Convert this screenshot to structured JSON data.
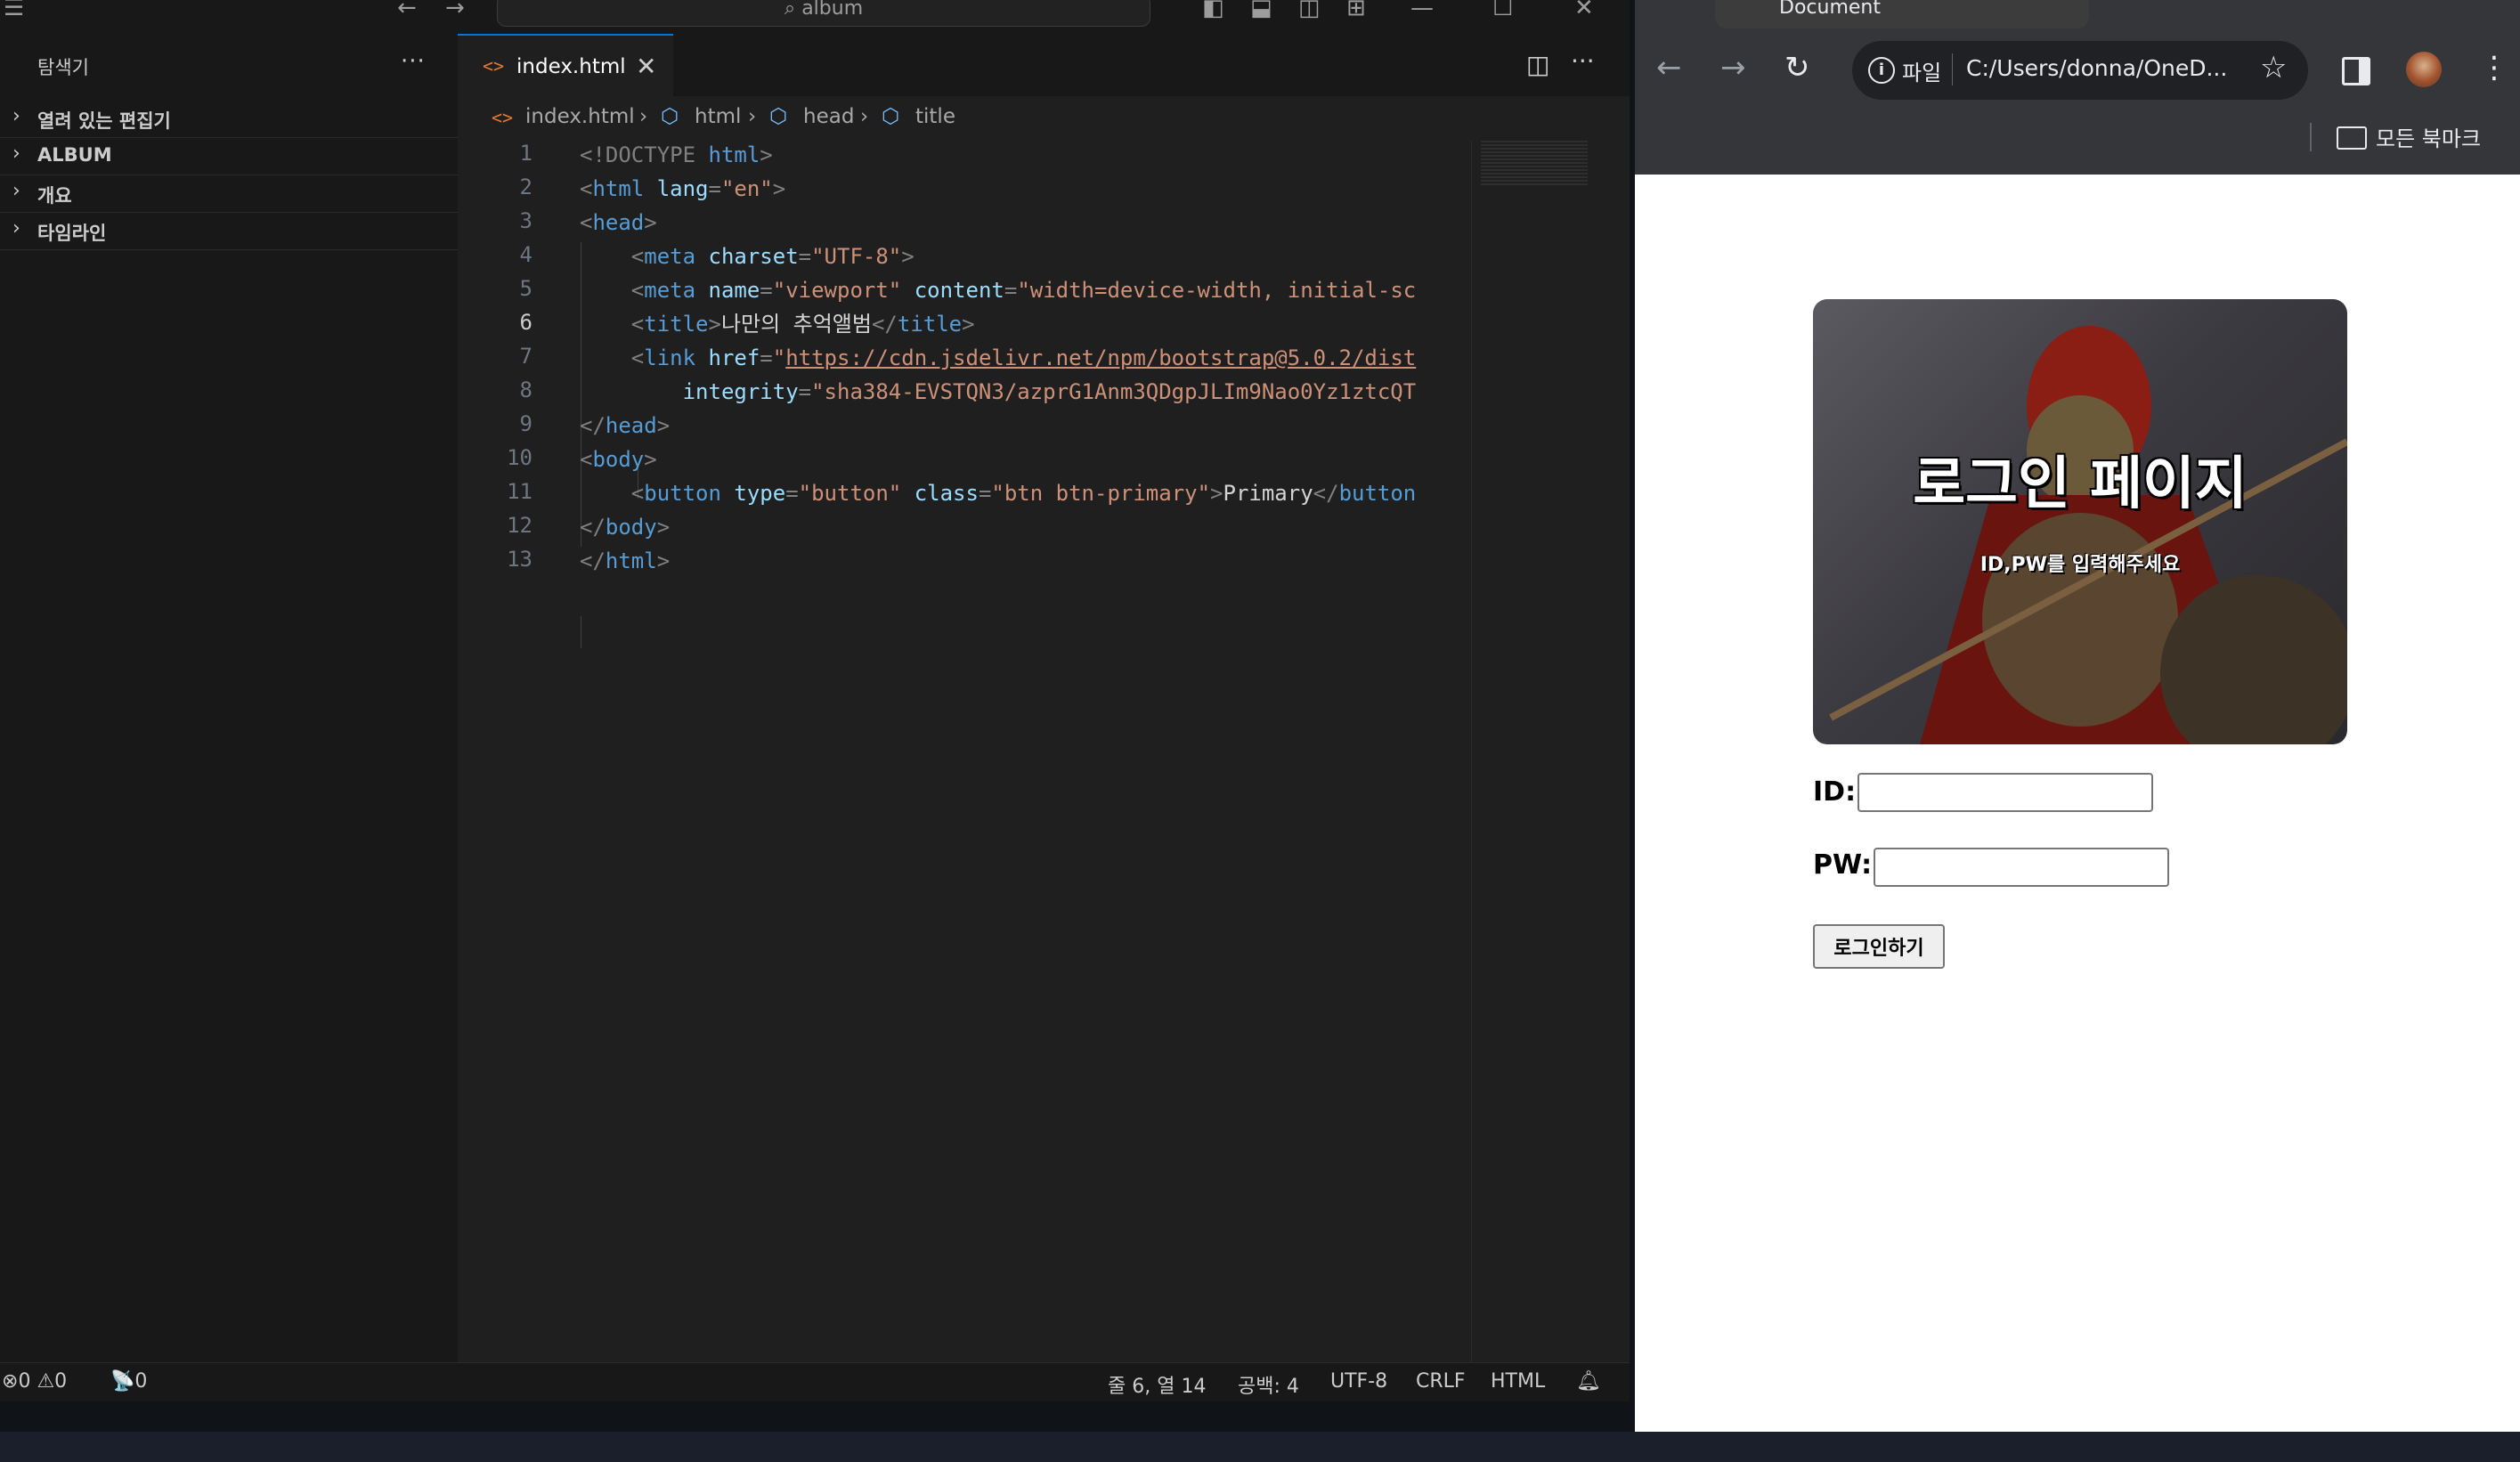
{
  "vscode": {
    "search_text": "album",
    "sidebar": {
      "title": "탐색기",
      "more": "···",
      "sections": [
        "열려 있는 편집기",
        "ALBUM",
        "개요",
        "타임라인"
      ]
    },
    "tab": {
      "label": "index.html"
    },
    "breadcrumb": [
      "index.html",
      "html",
      "head",
      "title"
    ],
    "line_numbers": [
      "1",
      "2",
      "3",
      "4",
      "5",
      "6",
      "7",
      "8",
      "9",
      "10",
      "11",
      "12",
      "13"
    ],
    "active_line": 6,
    "code": [
      [
        "<!DOCTYPE ",
        "html",
        ">"
      ],
      [
        "<",
        "html",
        " ",
        "lang",
        "=",
        "\"en\"",
        ">"
      ],
      [
        "<",
        "head",
        ">"
      ],
      [
        "    <",
        "meta",
        " ",
        "charset",
        "=",
        "\"UTF-8\"",
        ">"
      ],
      [
        "    <",
        "meta",
        " ",
        "name",
        "=",
        "\"viewport\"",
        " ",
        "content",
        "=",
        "\"width=device-width, initial-sc"
      ],
      [
        "    <",
        "title",
        ">",
        "나만의 추억앨범",
        "</",
        "title",
        ">"
      ],
      [
        "    <",
        "link",
        " ",
        "href",
        "=",
        "\"",
        "https://cdn.jsdelivr.net/npm/bootstrap@5.0.2/dist"
      ],
      [
        "        ",
        "integrity",
        "=",
        "\"sha384-EVSTQN3/azprG1Anm3QDgpJLIm9Nao0Yz1ztcQT"
      ],
      [
        "</",
        "head",
        ">"
      ],
      [
        "<",
        "body",
        ">"
      ],
      [
        "    <",
        "button",
        " ",
        "type",
        "=",
        "\"button\"",
        " ",
        "class",
        "=",
        "\"btn btn-primary\"",
        ">",
        "Primary",
        "</",
        "button"
      ],
      [
        "</",
        "body",
        ">"
      ],
      [
        "</",
        "html",
        ">"
      ]
    ],
    "status": {
      "errors": "0",
      "warnings": "0",
      "ports": "0",
      "position": "줄 6, 열 14",
      "spaces": "공백: 4",
      "encoding": "UTF-8",
      "eol": "CRLF",
      "language": "HTML"
    }
  },
  "chrome": {
    "tab_title": "Document",
    "scheme_label": "파일",
    "url": "C:/Users/donna/OneD...",
    "bookmarks_label": "모든 북마크",
    "page": {
      "hero_title": "로그인 페이지",
      "hero_subtitle": "ID,PW를 입력해주세요",
      "id_label": "ID:",
      "pw_label": "PW:",
      "id_value": "",
      "pw_value": "",
      "login_button": "로그인하기"
    }
  }
}
